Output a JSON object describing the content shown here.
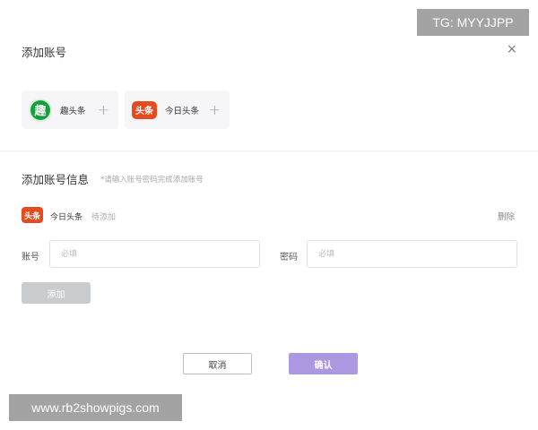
{
  "watermark_top": "TG: MYYJJPP",
  "dialog": {
    "title": "添加账号",
    "close_glyph": "×"
  },
  "platforms": [
    {
      "logo_text": "趣",
      "name": "趣头条",
      "add_glyph": "+"
    },
    {
      "logo_text": "头条",
      "name": "今日头条",
      "add_glyph": "+"
    }
  ],
  "account_info": {
    "title": "添加账号信息",
    "hint": "*请输入账号密码完成添加账号",
    "logo_text": "头条",
    "platform_name": "今日头条",
    "status": "待添加",
    "delete_label": "删除",
    "account_label": "账号",
    "account_placeholder": "必填",
    "password_label": "密码",
    "password_placeholder": "必填",
    "add_label": "添加"
  },
  "footer": {
    "cancel_label": "取消",
    "confirm_label": "确认"
  },
  "watermark_bottom": "www.rb2showpigs.com",
  "colors": {
    "qutoutiao_green": "#16a03d",
    "toutiao_red": "#e64b1f",
    "confirm_purple": "#ab98e0",
    "disabled_gray": "#c9cccf"
  }
}
